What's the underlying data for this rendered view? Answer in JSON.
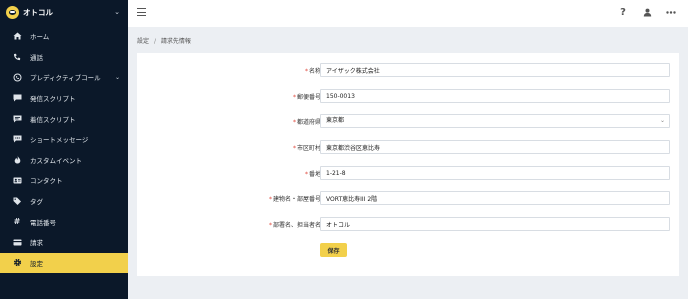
{
  "app": {
    "name": "オトコル"
  },
  "sidebar": {
    "items": [
      {
        "label": "ホーム",
        "icon": "home-icon"
      },
      {
        "label": "通話",
        "icon": "phone-icon"
      },
      {
        "label": "プレディクティブコール",
        "icon": "predictive-call-icon",
        "expandable": true
      },
      {
        "label": "発信スクリプト",
        "icon": "comment-icon"
      },
      {
        "label": "着信スクリプト",
        "icon": "comment-alt-icon"
      },
      {
        "label": "ショートメッセージ",
        "icon": "chat-icon"
      },
      {
        "label": "カスタムイベント",
        "icon": "fire-icon"
      },
      {
        "label": "コンタクト",
        "icon": "contact-card-icon"
      },
      {
        "label": "タグ",
        "icon": "tags-icon"
      },
      {
        "label": "電話番号",
        "icon": "hash-icon"
      },
      {
        "label": "請求",
        "icon": "credit-card-icon"
      },
      {
        "label": "設定",
        "icon": "gear-icon",
        "active": true
      }
    ]
  },
  "breadcrumb": {
    "parent": "設定",
    "separator": "/",
    "current": "請求先情報"
  },
  "form": {
    "required_mark": "*",
    "fields": [
      {
        "label": "名称：",
        "value": "アイザック株式会社"
      },
      {
        "label": "郵便番号：",
        "value": "150-0013"
      },
      {
        "label": "都道府県：",
        "value": "東京都",
        "type": "select"
      },
      {
        "label": "市区町村：",
        "value": "東京都渋谷区恵比寿"
      },
      {
        "label": "番地：",
        "value": "1-21-8"
      },
      {
        "label": "建物名・部屋番号：",
        "value": "VORT恵比寿III 2階"
      },
      {
        "label": "部署名、担当者名：",
        "value": "オトコル"
      }
    ],
    "save_label": "保存"
  },
  "colors": {
    "sidebar_bg": "#0b1829",
    "accent": "#f2d04b",
    "required": "#e0463a"
  }
}
